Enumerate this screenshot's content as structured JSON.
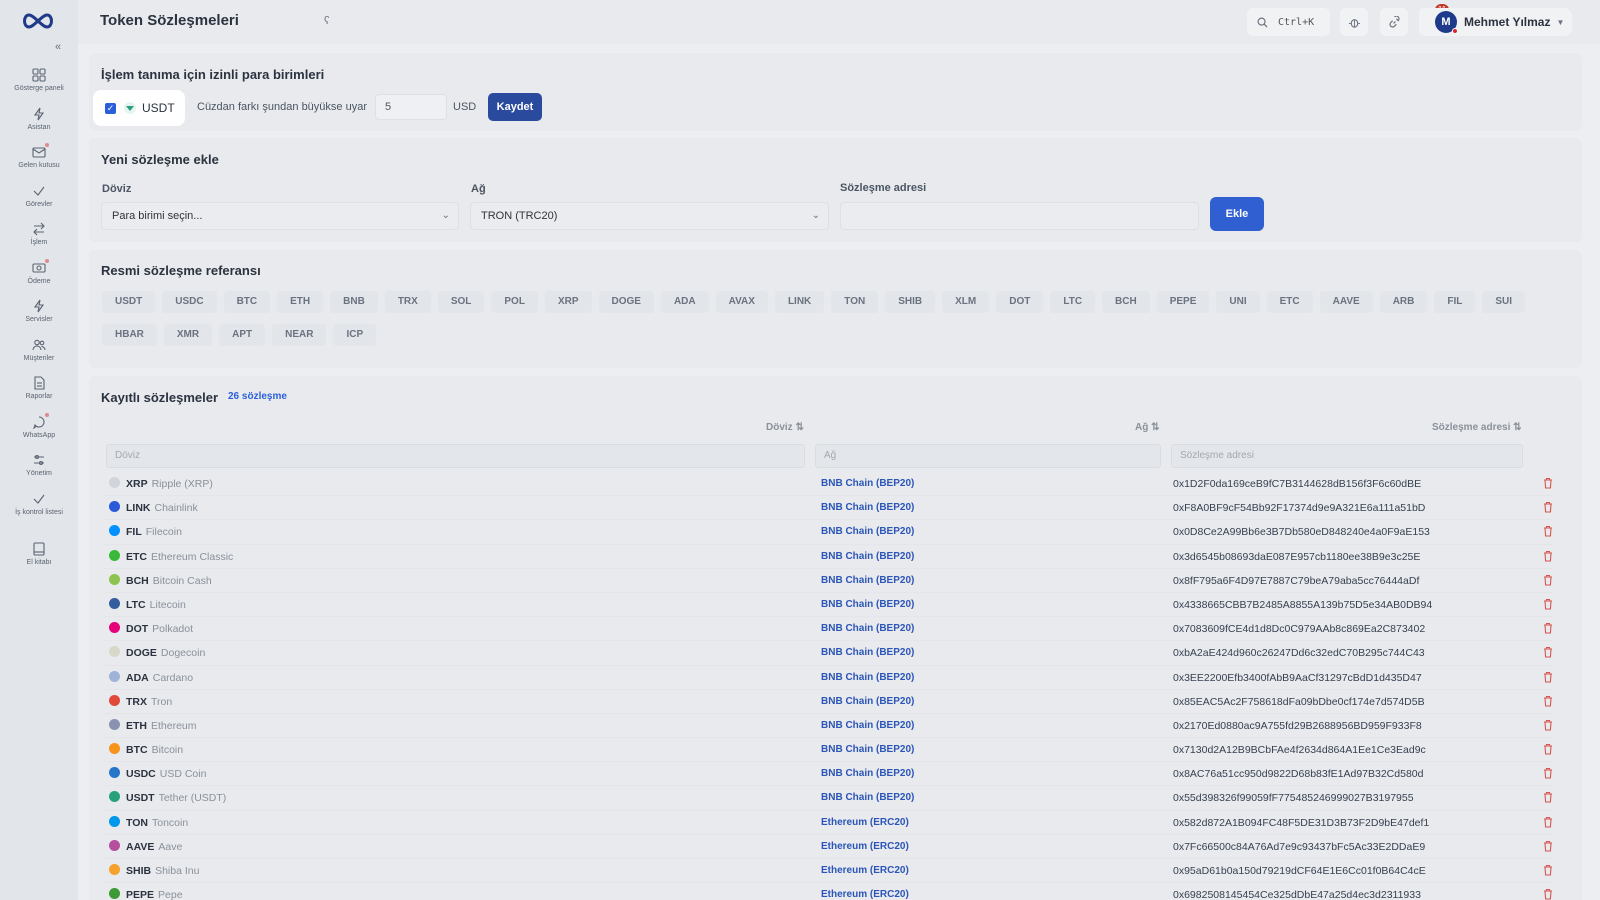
{
  "app": {
    "title": "Token Sözleşmeleri",
    "title_mark": "ʕ"
  },
  "sidebar": {
    "collapse": "«",
    "items": [
      {
        "label": "Gösterge paneli",
        "icon": "dashboard-icon"
      },
      {
        "label": "Asistan",
        "icon": "bolt-icon"
      },
      {
        "label": "Gelen kutusu",
        "icon": "inbox-icon"
      },
      {
        "label": "Görevler",
        "icon": "check-icon"
      },
      {
        "label": "İşlem",
        "icon": "transfer-icon"
      },
      {
        "label": "Ödeme",
        "icon": "payment-icon"
      },
      {
        "label": "Servisler",
        "icon": "bolt-icon"
      },
      {
        "label": "Müşteriler",
        "icon": "users-icon"
      },
      {
        "label": "Raporlar",
        "icon": "report-icon"
      },
      {
        "label": "WhatsApp",
        "icon": "chat-icon"
      },
      {
        "label": "Yönetim",
        "icon": "settings-icon"
      },
      {
        "label": "İş kontrol listesi",
        "icon": "checklist-icon"
      },
      {
        "label": "El kitabı",
        "icon": "book-icon"
      }
    ]
  },
  "topbar": {
    "search_shortcut": "Ctrl+K",
    "notifications_count": "11",
    "user": {
      "initial": "M",
      "name": "Mehmet Yılmaz"
    }
  },
  "allowed": {
    "title": "İşlem tanıma için izinli para birimleri",
    "currency": "USDT",
    "warn_label": "Cüzdan farkı şundan büyükse uyar",
    "warn_value": "5",
    "warn_unit": "USD",
    "save_label": "Kaydet"
  },
  "add_contract": {
    "title": "Yeni sözleşme ekle",
    "currency_label": "Döviz",
    "currency_placeholder": "Para birimi seçin...",
    "network_label": "Ağ",
    "network_value": "TRON (TRC20)",
    "address_label": "Sözleşme adresi",
    "address_value": "",
    "add_label": "Ekle"
  },
  "reference": {
    "title": "Resmi sözleşme referansı",
    "tickers": [
      "USDT",
      "USDC",
      "BTC",
      "ETH",
      "BNB",
      "TRX",
      "SOL",
      "POL",
      "XRP",
      "DOGE",
      "ADA",
      "AVAX",
      "LINK",
      "TON",
      "SHIB",
      "XLM",
      "DOT",
      "LTC",
      "BCH",
      "PEPE",
      "UNI",
      "ETC",
      "AAVE",
      "ARB",
      "FIL",
      "SUI",
      "HBAR",
      "XMR",
      "APT",
      "NEAR",
      "ICP"
    ]
  },
  "registered": {
    "title": "Kayıtlı sözleşmeler",
    "count_label": "26 sözleşme",
    "columns": {
      "currency": "Döviz ⇅",
      "network": "Ağ ⇅",
      "address": "Sözleşme adresi ⇅"
    },
    "filters": {
      "currency": "Döviz",
      "network": "Ağ",
      "address": "Sözleşme adresi"
    },
    "rows": [
      {
        "symbol": "XRP",
        "name": "Ripple (XRP)",
        "network": "BNB Chain (BEP20)",
        "address": "0x1D2F0da169ceB9fC7B3144628dB156f3F6c60dBE",
        "color": "#d1d5db"
      },
      {
        "symbol": "LINK",
        "name": "Chainlink",
        "network": "BNB Chain (BEP20)",
        "address": "0xF8A0BF9cF54Bb92F17374d9e9A321E6a111a51bD",
        "color": "#2a5ada"
      },
      {
        "symbol": "FIL",
        "name": "Filecoin",
        "network": "BNB Chain (BEP20)",
        "address": "0x0D8Ce2A99Bb6e3B7Db580eD848240e4a0F9aE153",
        "color": "#0090ff"
      },
      {
        "symbol": "ETC",
        "name": "Ethereum Classic",
        "network": "BNB Chain (BEP20)",
        "address": "0x3d6545b08693daE087E957cb1180ee38B9e3c25E",
        "color": "#3ab83a"
      },
      {
        "symbol": "BCH",
        "name": "Bitcoin Cash",
        "network": "BNB Chain (BEP20)",
        "address": "0x8fF795a6F4D97E7887C79beA79aba5cc76444aDf",
        "color": "#8dc351"
      },
      {
        "symbol": "LTC",
        "name": "Litecoin",
        "network": "BNB Chain (BEP20)",
        "address": "0x4338665CBB7B2485A8855A139b75D5e34AB0DB94",
        "color": "#345d9d"
      },
      {
        "symbol": "DOT",
        "name": "Polkadot",
        "network": "BNB Chain (BEP20)",
        "address": "0x7083609fCE4d1d8Dc0C979AAb8c869Ea2C873402",
        "color": "#e6007a"
      },
      {
        "symbol": "DOGE",
        "name": "Dogecoin",
        "network": "BNB Chain (BEP20)",
        "address": "0xbA2aE424d960c26247Dd6c32edC70B295c744C43",
        "color": "#d8d8c8"
      },
      {
        "symbol": "ADA",
        "name": "Cardano",
        "network": "BNB Chain (BEP20)",
        "address": "0x3EE2200Efb3400fAbB9AaCf31297cBdD1d435D47",
        "color": "#9fb3d8"
      },
      {
        "symbol": "TRX",
        "name": "Tron",
        "network": "BNB Chain (BEP20)",
        "address": "0x85EAC5Ac2F758618dFa09bDbe0cf174e7d574D5B",
        "color": "#e0483a"
      },
      {
        "symbol": "ETH",
        "name": "Ethereum",
        "network": "BNB Chain (BEP20)",
        "address": "0x2170Ed0880ac9A755fd29B2688956BD959F933F8",
        "color": "#8a92b2"
      },
      {
        "symbol": "BTC",
        "name": "Bitcoin",
        "network": "BNB Chain (BEP20)",
        "address": "0x7130d2A12B9BCbFAe4f2634d864A1Ee1Ce3Ead9c",
        "color": "#f7931a"
      },
      {
        "symbol": "USDC",
        "name": "USD Coin",
        "network": "BNB Chain (BEP20)",
        "address": "0x8AC76a51cc950d9822D68b83fE1Ad97B32Cd580d",
        "color": "#2775ca"
      },
      {
        "symbol": "USDT",
        "name": "Tether (USDT)",
        "network": "BNB Chain (BEP20)",
        "address": "0x55d398326f99059fF775485246999027B3197955",
        "color": "#26a17b"
      },
      {
        "symbol": "TON",
        "name": "Toncoin",
        "network": "Ethereum (ERC20)",
        "address": "0x582d872A1B094FC48F5DE31D3B73F2D9bE47def1",
        "color": "#0098ea"
      },
      {
        "symbol": "AAVE",
        "name": "Aave",
        "network": "Ethereum (ERC20)",
        "address": "0x7Fc66500c84A76Ad7e9c93437bFc5Ac33E2DDaE9",
        "color": "#b6509e"
      },
      {
        "symbol": "SHIB",
        "name": "Shiba Inu",
        "network": "Ethereum (ERC20)",
        "address": "0x95aD61b0a150d79219dCF64E1E6Cc01f0B64C4cE",
        "color": "#f6a12c"
      },
      {
        "symbol": "PEPE",
        "name": "Pepe",
        "network": "Ethereum (ERC20)",
        "address": "0x6982508145454Ce325dDbE47a25d4ec3d2311933",
        "color": "#3d9a37"
      }
    ]
  },
  "colors": {
    "accent": "#2a4a9e",
    "link": "#2b55b8",
    "delete": "#d9534f"
  }
}
